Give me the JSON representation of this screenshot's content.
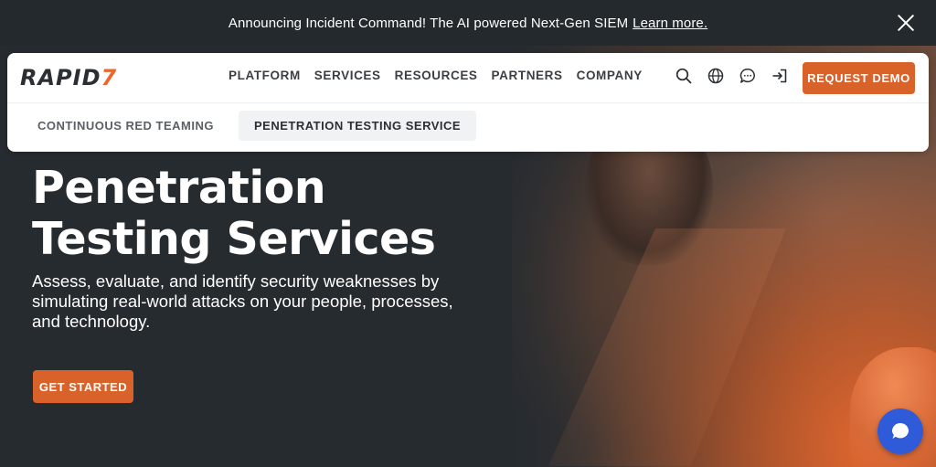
{
  "announcement": {
    "text": "Announcing Incident Command! The AI powered Next-Gen SIEM",
    "link": "Learn more."
  },
  "logo": {
    "text": "RAPID",
    "mark": "7"
  },
  "nav": {
    "items": [
      {
        "label": "PLATFORM"
      },
      {
        "label": "SERVICES"
      },
      {
        "label": "RESOURCES"
      },
      {
        "label": "PARTNERS"
      },
      {
        "label": "COMPANY"
      }
    ],
    "icons": [
      "search-icon",
      "globe-icon",
      "chat-icon",
      "login-icon"
    ],
    "demo_button": "REQUEST DEMO"
  },
  "subnav": {
    "items": [
      {
        "label": "CONTINUOUS RED TEAMING",
        "active": false
      },
      {
        "label": "PENETRATION TESTING SERVICE",
        "active": true
      }
    ]
  },
  "hero": {
    "title_line1": "Penetration",
    "title_line2": "Testing Services",
    "subtitle": "Assess, evaluate, and identify security weaknesses by simulating real-world attacks on your people, processes, and technology.",
    "cta": "GET STARTED"
  },
  "colors": {
    "accent": "#d9622b",
    "dark_bg": "#262b30",
    "chat": "#2f5bd8"
  }
}
